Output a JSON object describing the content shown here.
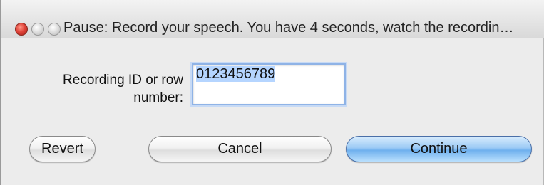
{
  "window": {
    "title": "Pause: Record your speech. You have 4 seconds, watch the recordin…"
  },
  "form": {
    "label": "Recording ID or row number:",
    "field_value": "0123456789"
  },
  "buttons": {
    "revert": "Revert",
    "cancel": "Cancel",
    "continue": "Continue"
  },
  "colors": {
    "default_button": "#6fb0ee",
    "focus_ring": "#8fb3e6",
    "selection": "#b5d5ff"
  }
}
